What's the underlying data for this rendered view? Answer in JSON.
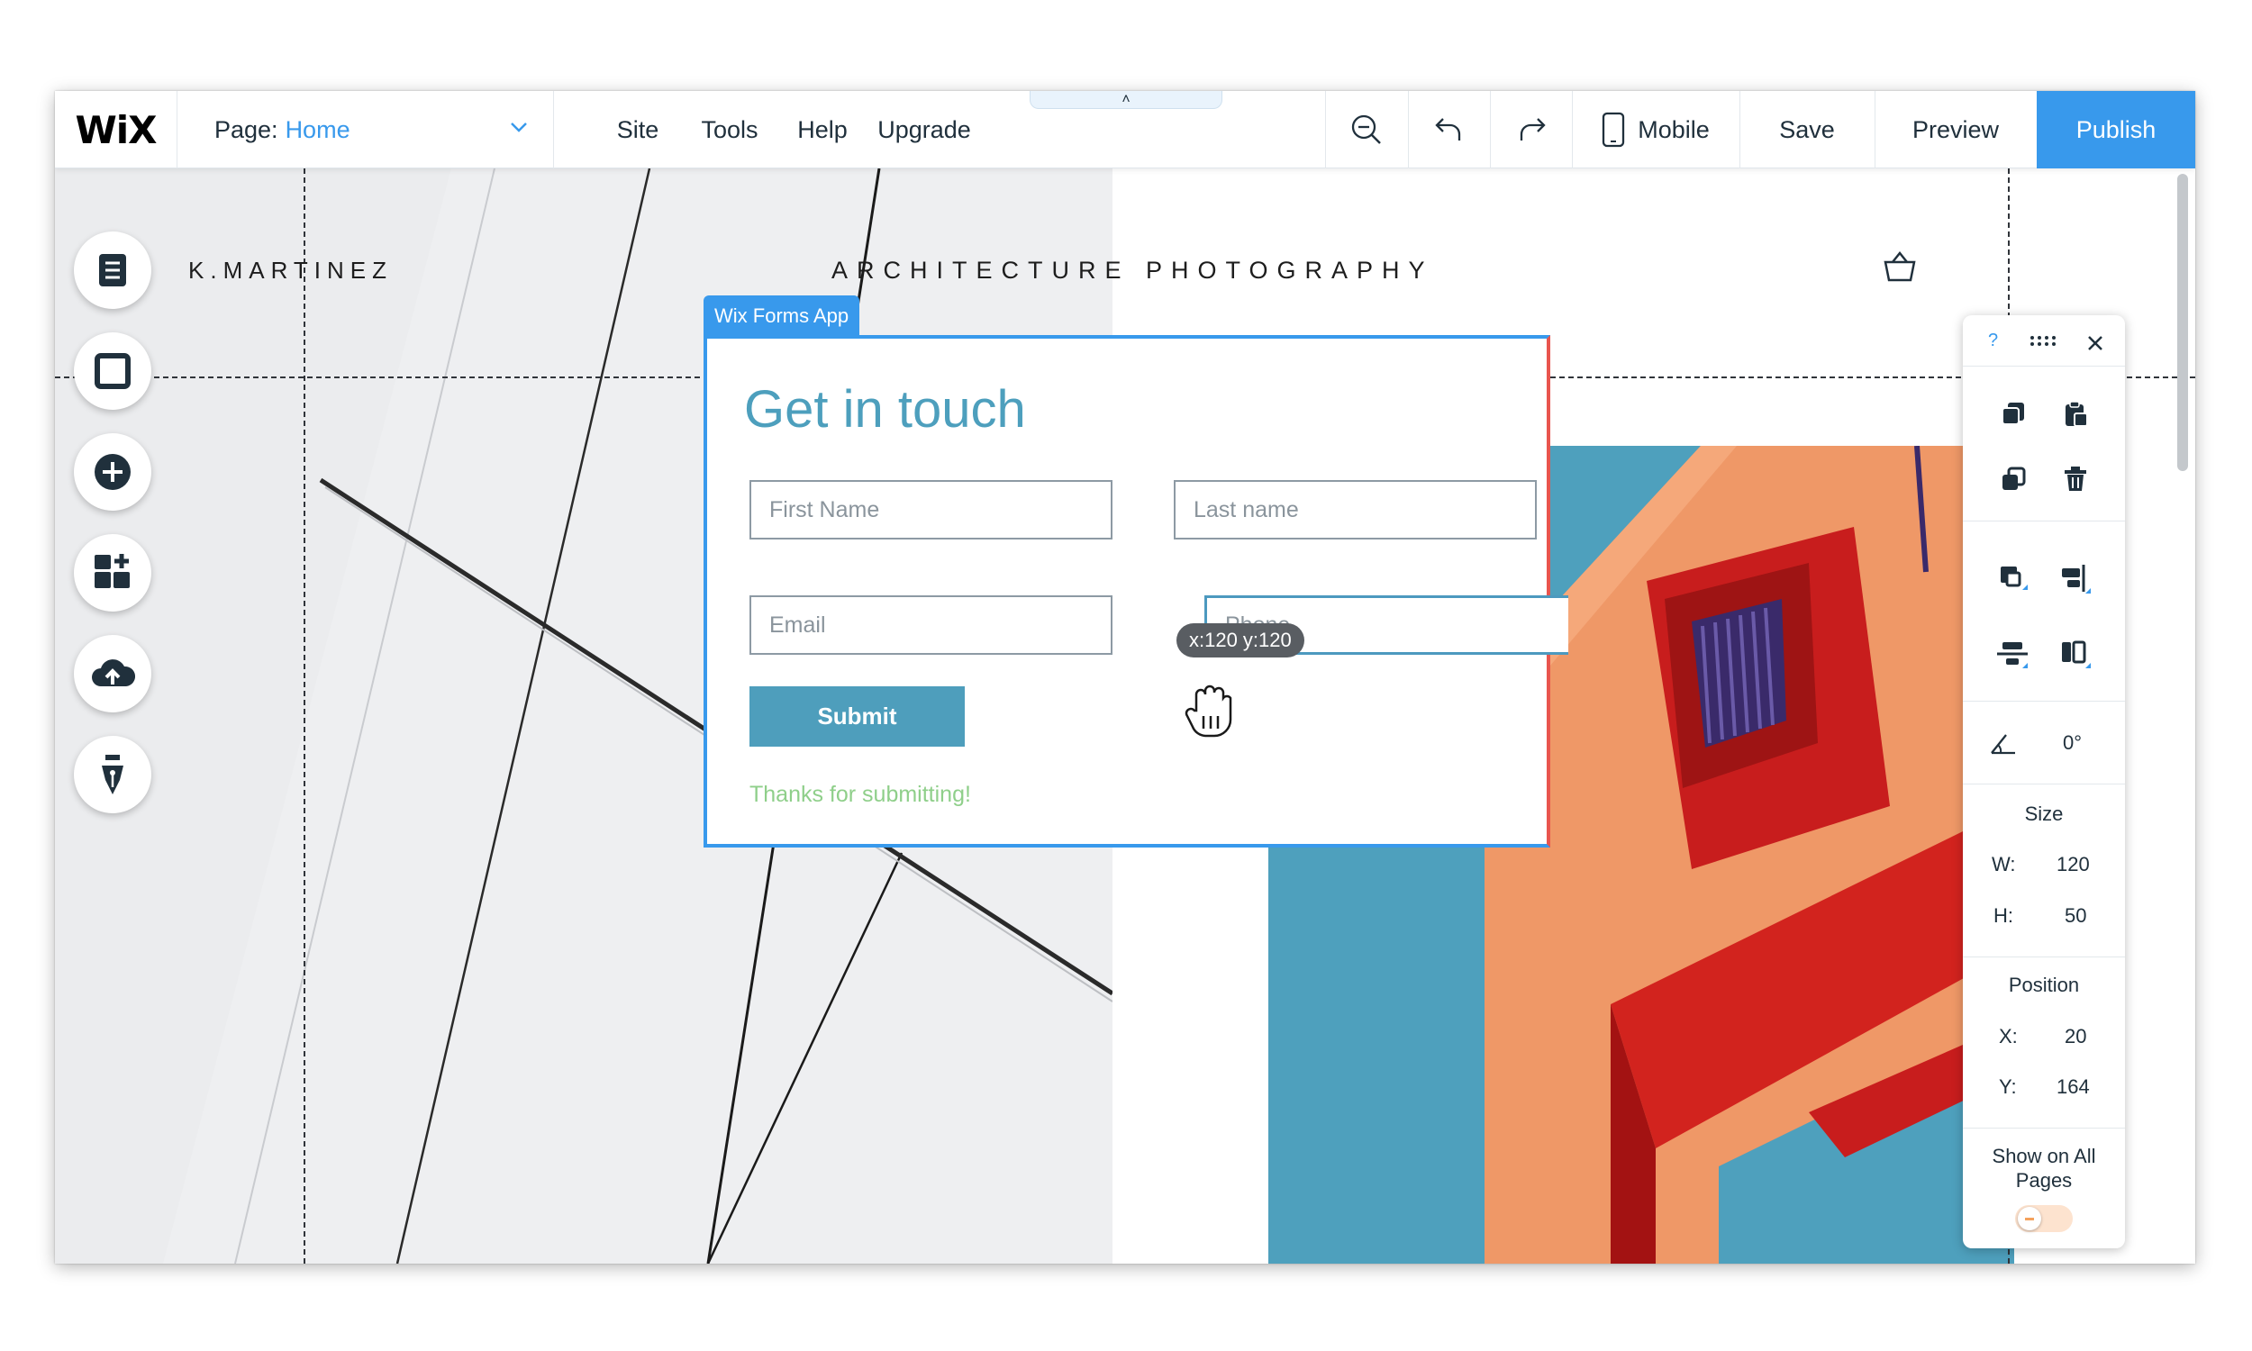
{
  "topbar": {
    "logo": "WiX",
    "page_label": "Page:",
    "page_name": "Home",
    "menu": [
      "Site",
      "Tools",
      "Help",
      "Upgrade"
    ],
    "mobile_label": "Mobile",
    "save_label": "Save",
    "preview_label": "Preview",
    "publish_label": "Publish",
    "handle_glyph": "˄"
  },
  "site": {
    "name": "K.MARTINEZ",
    "tagline": "ARCHITECTURE PHOTOGRAPHY"
  },
  "form": {
    "badge": "Wix Forms App",
    "title": "Get in touch",
    "first_name_placeholder": "First Name",
    "last_name_placeholder": "Last name",
    "email_placeholder": "Email",
    "phone_placeholder": "Phone",
    "submit_label": "Submit",
    "thanks": "Thanks for submitting!"
  },
  "tooltip": {
    "coords": "x:120 y:120"
  },
  "panel": {
    "help": "?",
    "rotation_value": "0°",
    "size_label": "Size",
    "width_label": "W:",
    "width_value": "120",
    "height_label": "H:",
    "height_value": "50",
    "position_label": "Position",
    "x_label": "X:",
    "x_value": "20",
    "y_label": "Y:",
    "y_value": "164",
    "show_all_label": "Show on All Pages",
    "show_all_on": false
  },
  "colors": {
    "accent": "#3899ec",
    "form_title": "#4d9fbd",
    "submit_bg": "#4e9ebc",
    "thanks": "#8fcf8a",
    "toggle": "#f5a25d"
  }
}
